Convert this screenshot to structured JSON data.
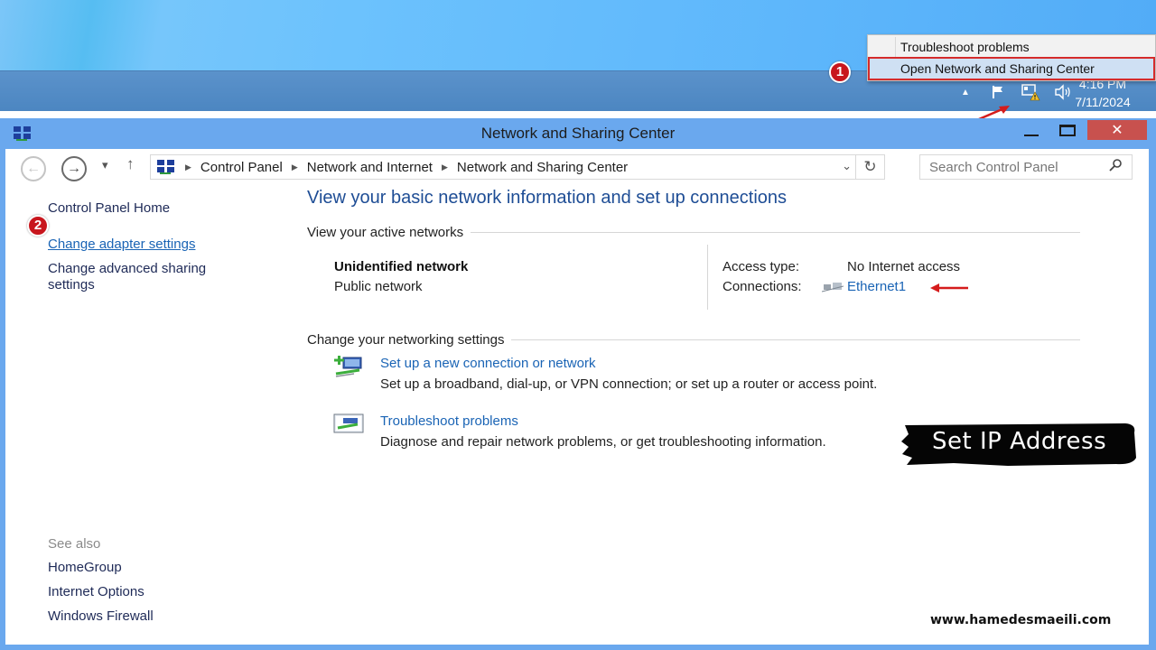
{
  "context_menu": {
    "items": [
      {
        "label": "Troubleshoot problems"
      },
      {
        "label": "Open Network and Sharing Center",
        "highlighted": true
      }
    ]
  },
  "taskbar": {
    "tray_icons": [
      "show-hidden-icons",
      "action-center-flag-icon",
      "network-warning-icon",
      "volume-icon"
    ],
    "time": "4:16 PM",
    "date": "7/11/2024"
  },
  "annotations": {
    "step1": "1",
    "step2": "2",
    "color": "#c8161d"
  },
  "window": {
    "title": "Network and Sharing Center",
    "controls": {
      "minimize": "—",
      "maximize": "□",
      "close": "✕"
    }
  },
  "navigation": {
    "back_icon": "←",
    "forward_icon": "→",
    "recent_icon": "▾",
    "up_icon": "↑",
    "breadcrumb": [
      "Control Panel",
      "Network and Internet",
      "Network and Sharing Center"
    ],
    "dropdown_icon": "⌄",
    "refresh_icon": "↻",
    "search_placeholder": "Search Control Panel",
    "search_icon": "⚲"
  },
  "left_pane": {
    "home": "Control Panel Home",
    "links": [
      {
        "label": "Change adapter settings"
      },
      {
        "label": "Change advanced sharing"
      },
      {
        "label": "settings"
      }
    ],
    "see_also_title": "See also",
    "see_also": [
      "HomeGroup",
      "Internet Options",
      "Windows Firewall"
    ]
  },
  "main": {
    "title": "View your basic network information and set up connections",
    "active_networks_heading": "View your active networks",
    "network": {
      "name": "Unidentified network",
      "category": "Public network",
      "access_type_label": "Access type:",
      "access_type_value": "No Internet access",
      "connections_label": "Connections:",
      "connection_name": "Ethernet1"
    },
    "change_settings_heading": "Change your networking settings",
    "tasks": [
      {
        "label": "Set up a new connection or network",
        "description": "Set up a broadband, dial-up, or VPN connection; or set up a router or access point."
      },
      {
        "label": "Troubleshoot problems",
        "description": "Diagnose and repair network problems, or get troubleshooting information."
      }
    ]
  },
  "overlay": {
    "tag": "Set IP Address",
    "website": "www.hamedesmaeili.com"
  }
}
